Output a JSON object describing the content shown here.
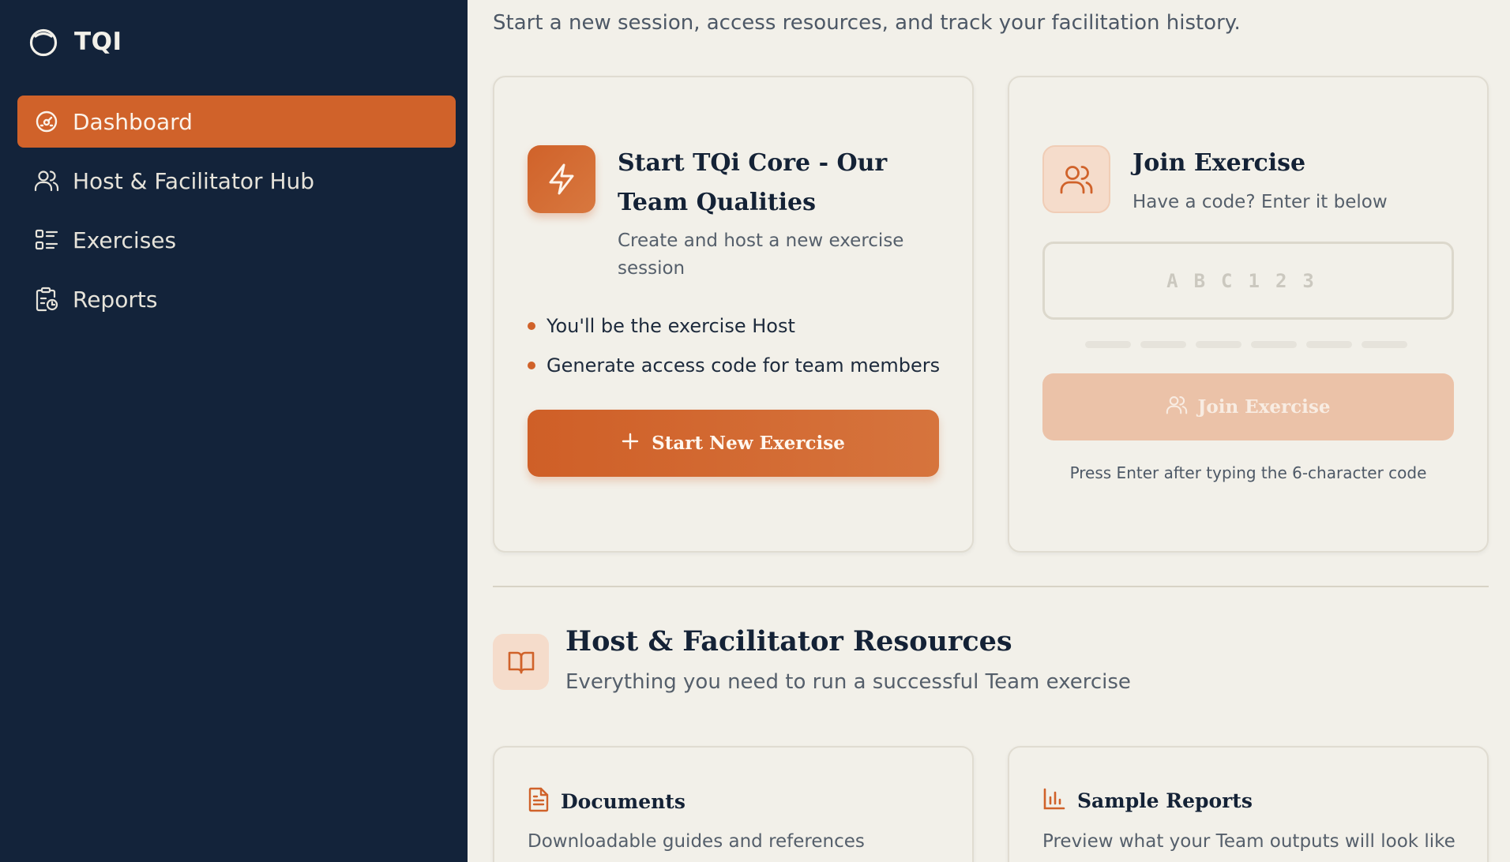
{
  "app": {
    "name": "TQI"
  },
  "sidebar": {
    "items": [
      {
        "label": "Dashboard",
        "icon": "gauge-icon",
        "active": true
      },
      {
        "label": "Host & Facilitator Hub",
        "icon": "users-icon",
        "active": false
      },
      {
        "label": "Exercises",
        "icon": "list-icon",
        "active": false
      },
      {
        "label": "Reports",
        "icon": "clipboard-chart-icon",
        "active": false
      }
    ]
  },
  "main": {
    "subtitle": "Start a new session, access resources, and track your facilitation history.",
    "start_card": {
      "title": "Start TQi Core - Our Team Qualities",
      "description": "Create and host a new exercise session",
      "bullets": [
        "You'll be the exercise Host",
        "Generate access code for team members"
      ],
      "button_label": "Start New Exercise",
      "icon": "lightning-icon"
    },
    "join_card": {
      "title": "Join Exercise",
      "description": "Have a code? Enter it below",
      "input_placeholder": "ABC123",
      "button_label": "Join Exercise",
      "hint": "Press Enter after typing the 6-character code",
      "icon": "users-icon"
    },
    "resources": {
      "title": "Host & Facilitator Resources",
      "subtitle": "Everything you need to run a successful Team exercise",
      "icon": "book-icon",
      "cards": [
        {
          "title": "Documents",
          "description": "Downloadable guides and references",
          "icon": "document-icon"
        },
        {
          "title": "Sample Reports",
          "description": "Preview what your Team outputs will look like",
          "icon": "bar-chart-icon"
        }
      ]
    }
  },
  "colors": {
    "sidebar_bg": "#13233a",
    "accent": "#d0622a",
    "page_bg": "#f2f0e9"
  }
}
